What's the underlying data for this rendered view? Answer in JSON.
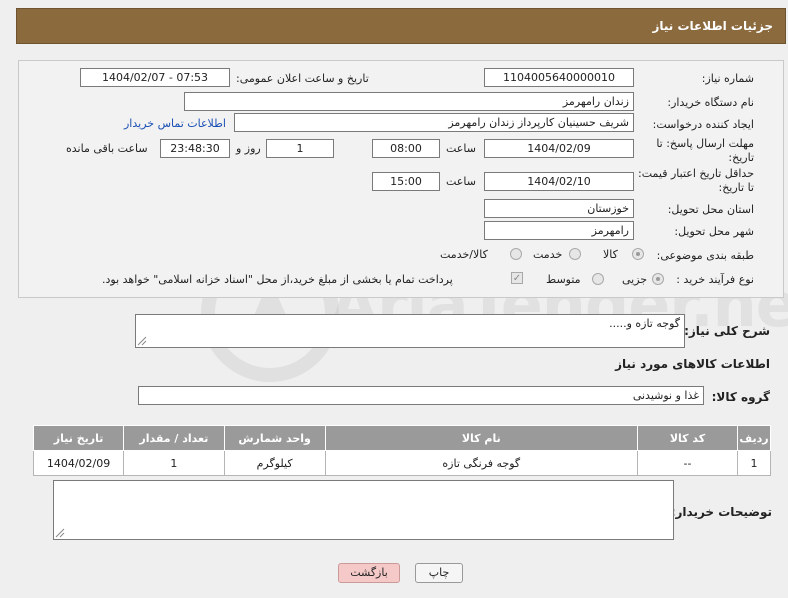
{
  "header": {
    "title": "جزئیات اطلاعات نیاز"
  },
  "form": {
    "need_number_label": "شماره نیاز:",
    "need_number": "1104005640000010",
    "announce_label": "تاریخ و ساعت اعلان عمومی:",
    "announce_value": "1404/02/07 - 07:53",
    "buyer_org_label": "نام دستگاه خریدار:",
    "buyer_org": "زندان رامهرمز",
    "creator_label": "ایجاد کننده درخواست:",
    "creator": "شریف حسینیان کارپرداز زندان رامهرمز",
    "contact_link": "اطلاعات تماس خریدار",
    "reply_label": "مهلت ارسال پاسخ: تا تاریخ:",
    "reply_date": "1404/02/09",
    "time_label": "ساعت",
    "reply_time": "08:00",
    "days_value": "1",
    "days_label": "روز و",
    "remaining_time": "23:48:30",
    "remaining_label": "ساعت باقی مانده",
    "price_label": "حداقل تاریخ اعتبار قیمت: تا تاریخ:",
    "price_date": "1404/02/10",
    "price_time": "15:00",
    "province_label": "استان محل تحویل:",
    "province": "خوزستان",
    "city_label": "شهر محل تحویل:",
    "city": "رامهرمز",
    "category_label": "طبقه بندی موضوعی:",
    "category_options": [
      "کالا",
      "خدمت",
      "کالا/خدمت"
    ],
    "purchase_type_label": "نوع فرآیند خرید :",
    "purchase_options": [
      "جزیی",
      "متوسط"
    ],
    "payment_note": "پرداخت تمام یا بخشی از مبلغ خرید،از محل \"اسناد خزانه اسلامی\" خواهد بود."
  },
  "description": {
    "label": "شرح کلی نیاز:",
    "value": "گوجه تازه و....."
  },
  "items_section": {
    "title": "اطلاعات کالاهای مورد نیاز",
    "group_label": "گروه کالا:",
    "group_value": "غذا و نوشیدنی"
  },
  "table": {
    "headers": [
      "ردیف",
      "کد کالا",
      "نام کالا",
      "واحد شمارش",
      "تعداد / مقدار",
      "تاریخ نیاز"
    ],
    "rows": [
      [
        "1",
        "--",
        "گوجه فرنگی تازه",
        "کیلوگرم",
        "1",
        "1404/02/09"
      ]
    ]
  },
  "buyer_notes": {
    "label": "توضیحات خریدار:"
  },
  "buttons": {
    "print": "چاپ",
    "back": "بازگشت"
  },
  "watermark": {
    "text": "AriaTender.net"
  },
  "colors": {
    "header_bg": "#8b6a3e",
    "table_header": "#9a9a9a",
    "link": "#1a4fb4",
    "back_button": "#f6c9c9"
  }
}
